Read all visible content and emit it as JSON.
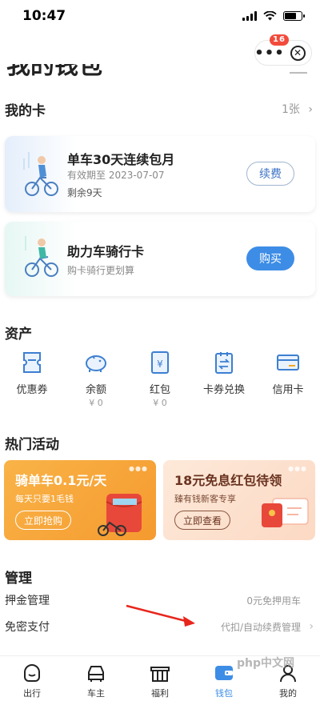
{
  "status_bar": {
    "time": "10:47"
  },
  "capsule": {
    "badge": "16"
  },
  "header": {
    "title_cut": "我的钱包"
  },
  "my_cards": {
    "heading": "我的卡",
    "count": "1张",
    "cards": [
      {
        "title": "单车30天连续包月",
        "valid_label": "有效期至 2023-07-07",
        "remaining": "剩余9天",
        "button": "续费"
      },
      {
        "title": "助力车骑行卡",
        "subtitle": "购卡骑行更划算",
        "button": "购买"
      }
    ]
  },
  "assets": {
    "heading": "资产",
    "items": [
      {
        "label": "优惠券",
        "value": "",
        "icon": "coupon-icon"
      },
      {
        "label": "余额",
        "value": "¥ 0",
        "icon": "piggy-bank-icon"
      },
      {
        "label": "红包",
        "value": "¥ 0",
        "icon": "red-packet-icon"
      },
      {
        "label": "卡券兑换",
        "value": "",
        "icon": "voucher-exchange-icon"
      },
      {
        "label": "信用卡",
        "value": "",
        "icon": "credit-card-icon"
      }
    ]
  },
  "activities": {
    "heading": "热门活动",
    "promos": [
      {
        "title": "骑单车0.1元/天",
        "subtitle": "每天只要1毛钱",
        "button": "立即抢购"
      },
      {
        "title": "18元免息红包待领",
        "subtitle": "臻有钱新客专享",
        "button": "立即查看"
      }
    ]
  },
  "management": {
    "heading": "管理",
    "rows": [
      {
        "label": "押金管理",
        "value": "0元免押用车"
      },
      {
        "label": "免密支付",
        "value": "代扣/自动续费管理"
      }
    ]
  },
  "tab_bar": {
    "tabs": [
      {
        "label": "出行",
        "icon": "travel-icon"
      },
      {
        "label": "车主",
        "icon": "car-owner-icon"
      },
      {
        "label": "福利",
        "icon": "gift-icon"
      },
      {
        "label": "钱包",
        "icon": "wallet-icon",
        "active": true
      },
      {
        "label": "我的",
        "icon": "profile-icon"
      }
    ],
    "watermark": "php中文网"
  },
  "colors": {
    "accent": "#3d8de6",
    "badge": "#f24b3c",
    "promo_orange": "#f7a43a",
    "promo_peach": "#fde3d0"
  }
}
